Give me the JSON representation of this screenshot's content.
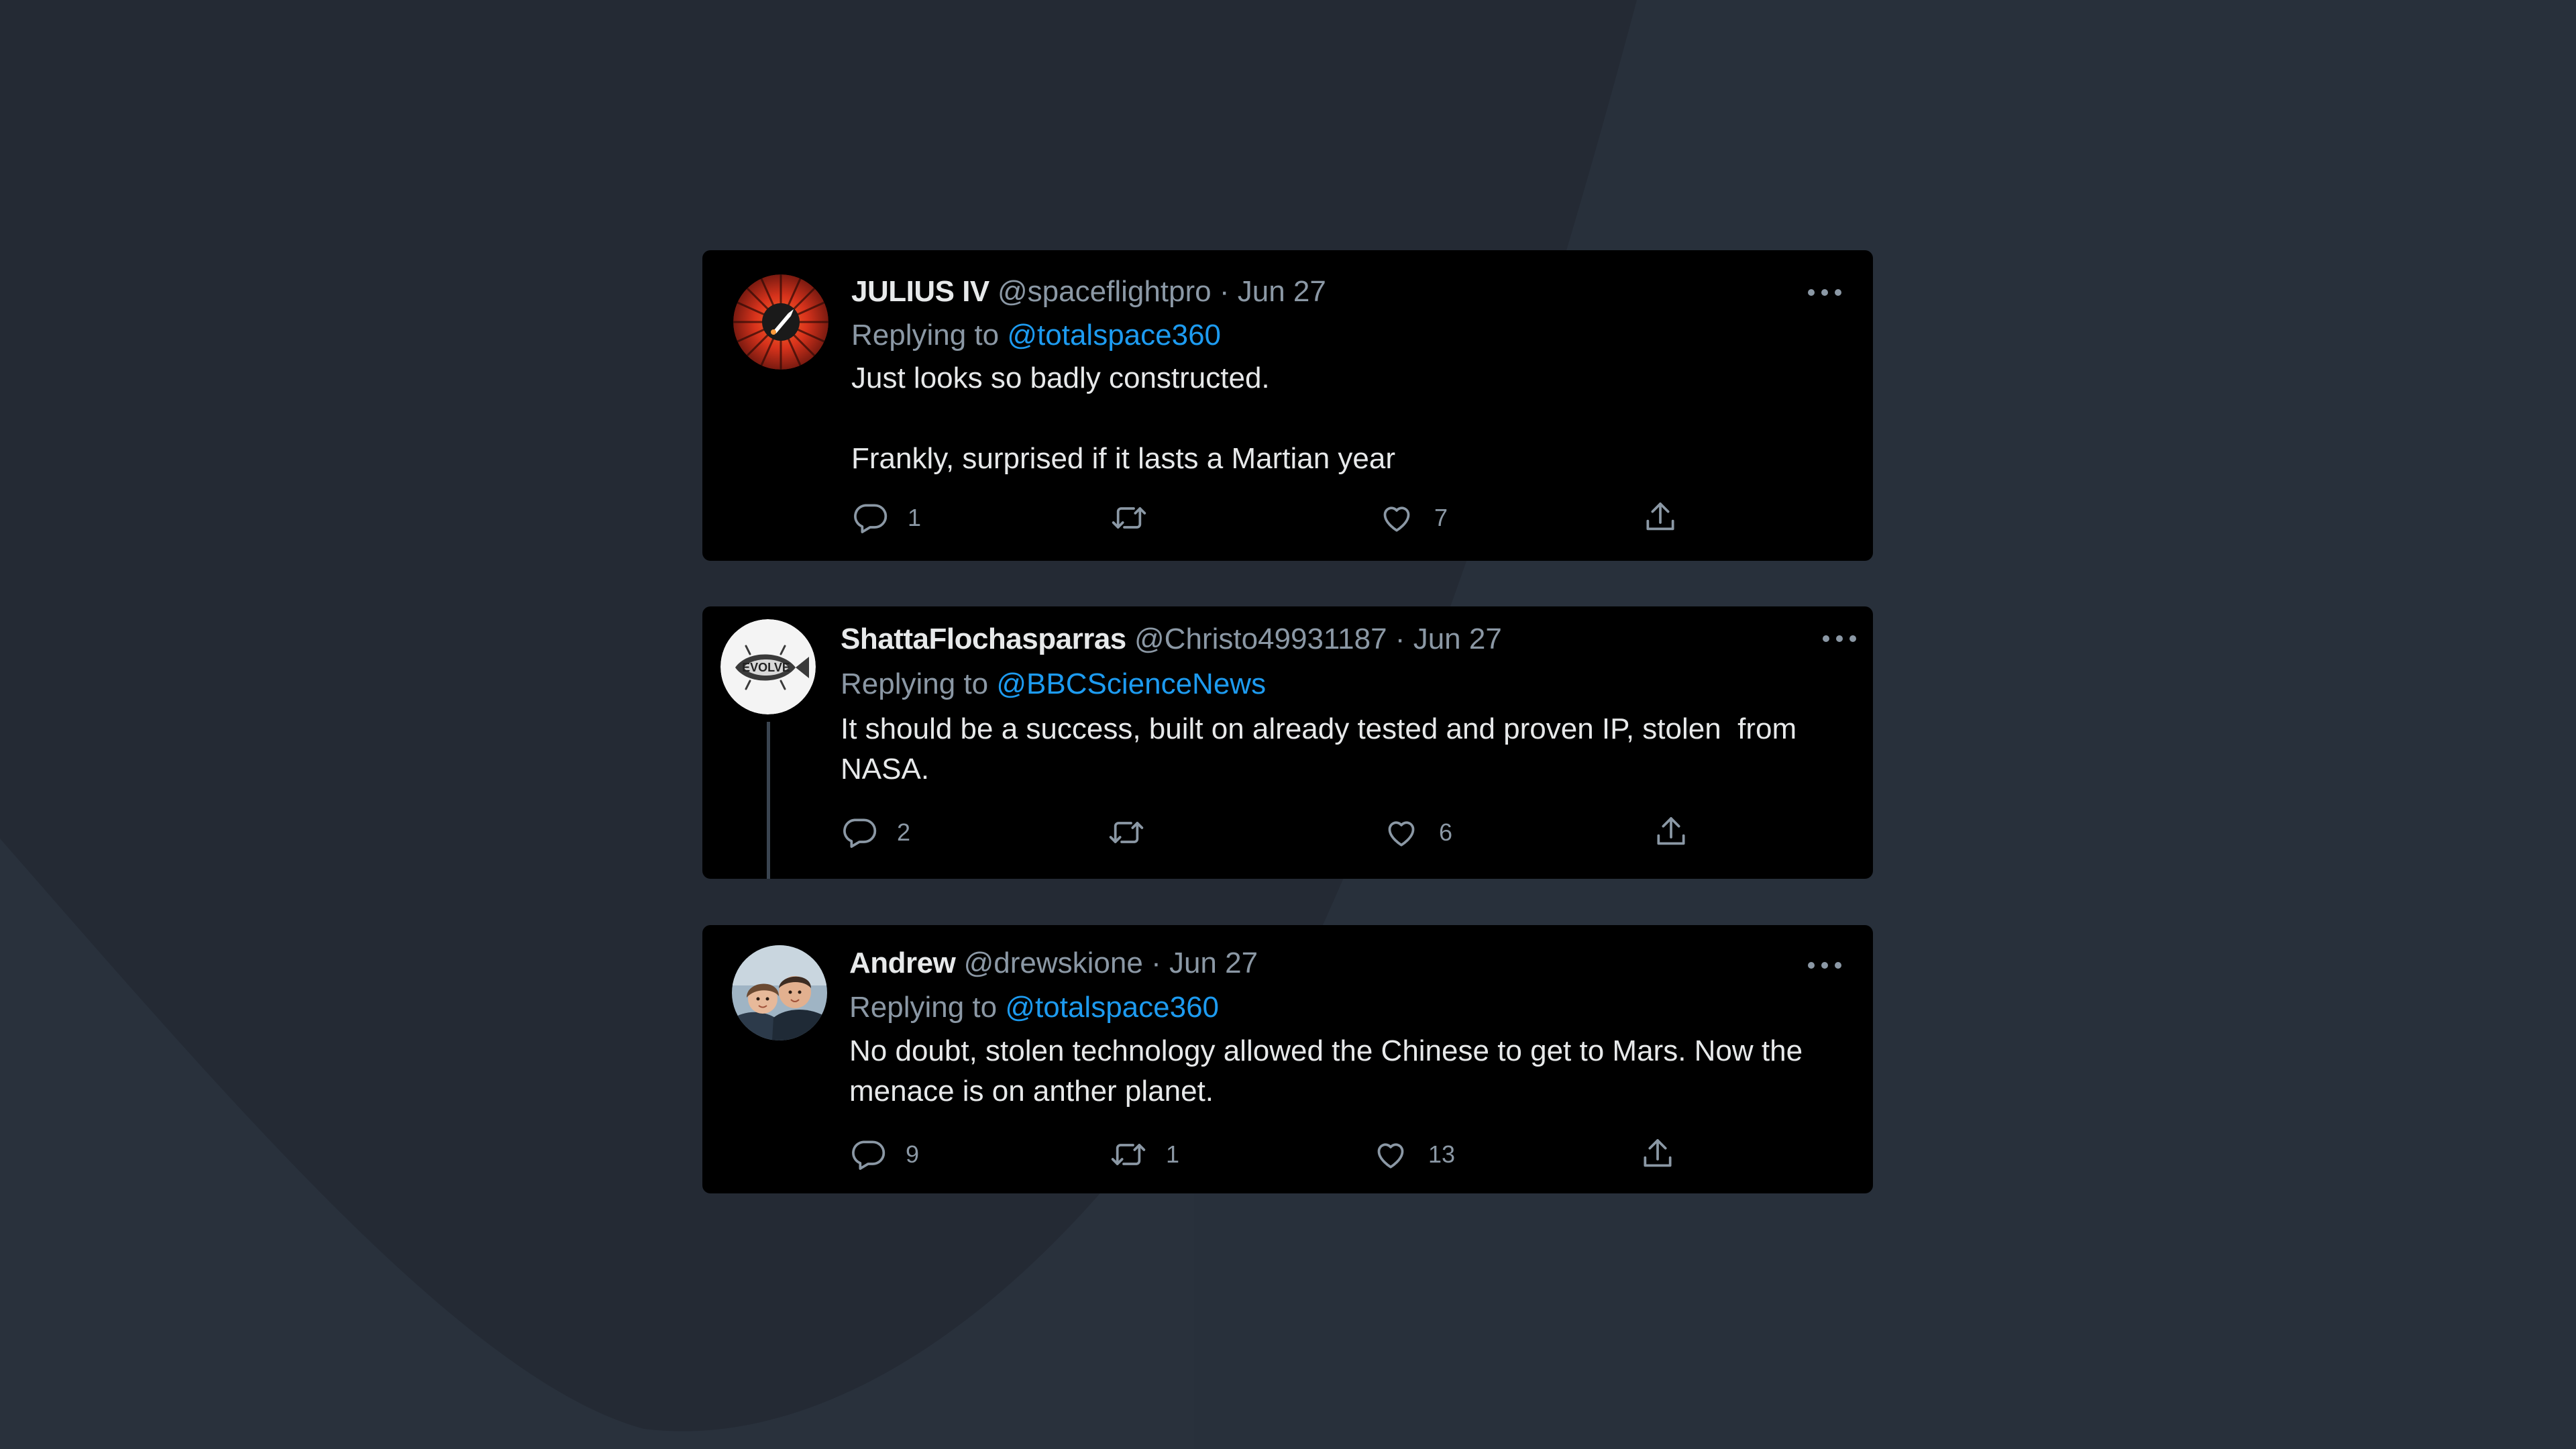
{
  "colors": {
    "background": "#242a34",
    "card": "#000000",
    "text": "#e7e9ea",
    "muted": "#8b98a5",
    "link": "#1d9bf0"
  },
  "tweets": [
    {
      "name": "JULIUS IV",
      "handle": "@spaceflightpro",
      "separator": "·",
      "date": "Jun 27",
      "replying_prefix": "Replying to",
      "replying_to": "@totalspace360",
      "text": "Just looks so badly constructed.\n\nFrankly, surprised if it lasts a Martian year",
      "reply_count": "1",
      "retweet_count": "",
      "like_count": "7",
      "avatar_icon": "rocket-sunburst-avatar"
    },
    {
      "name": "ShattaFlochasparras",
      "handle": "@Christo49931187",
      "separator": "·",
      "date": "Jun 27",
      "replying_prefix": "Replying to",
      "replying_to": "@BBCScienceNews",
      "text": "It should be a success, built on already tested and proven IP, stolen  from NASA.",
      "reply_count": "2",
      "retweet_count": "",
      "like_count": "6",
      "avatar_icon": "evolve-fish-avatar"
    },
    {
      "name": "Andrew",
      "handle": "@drewskione",
      "separator": "·",
      "date": "Jun 27",
      "replying_prefix": "Replying to",
      "replying_to": "@totalspace360",
      "text": "No doubt, stolen technology allowed the Chinese to get to Mars. Now the menace is on anther planet.",
      "reply_count": "9",
      "retweet_count": "1",
      "like_count": "13",
      "avatar_icon": "couple-photo-avatar"
    }
  ]
}
